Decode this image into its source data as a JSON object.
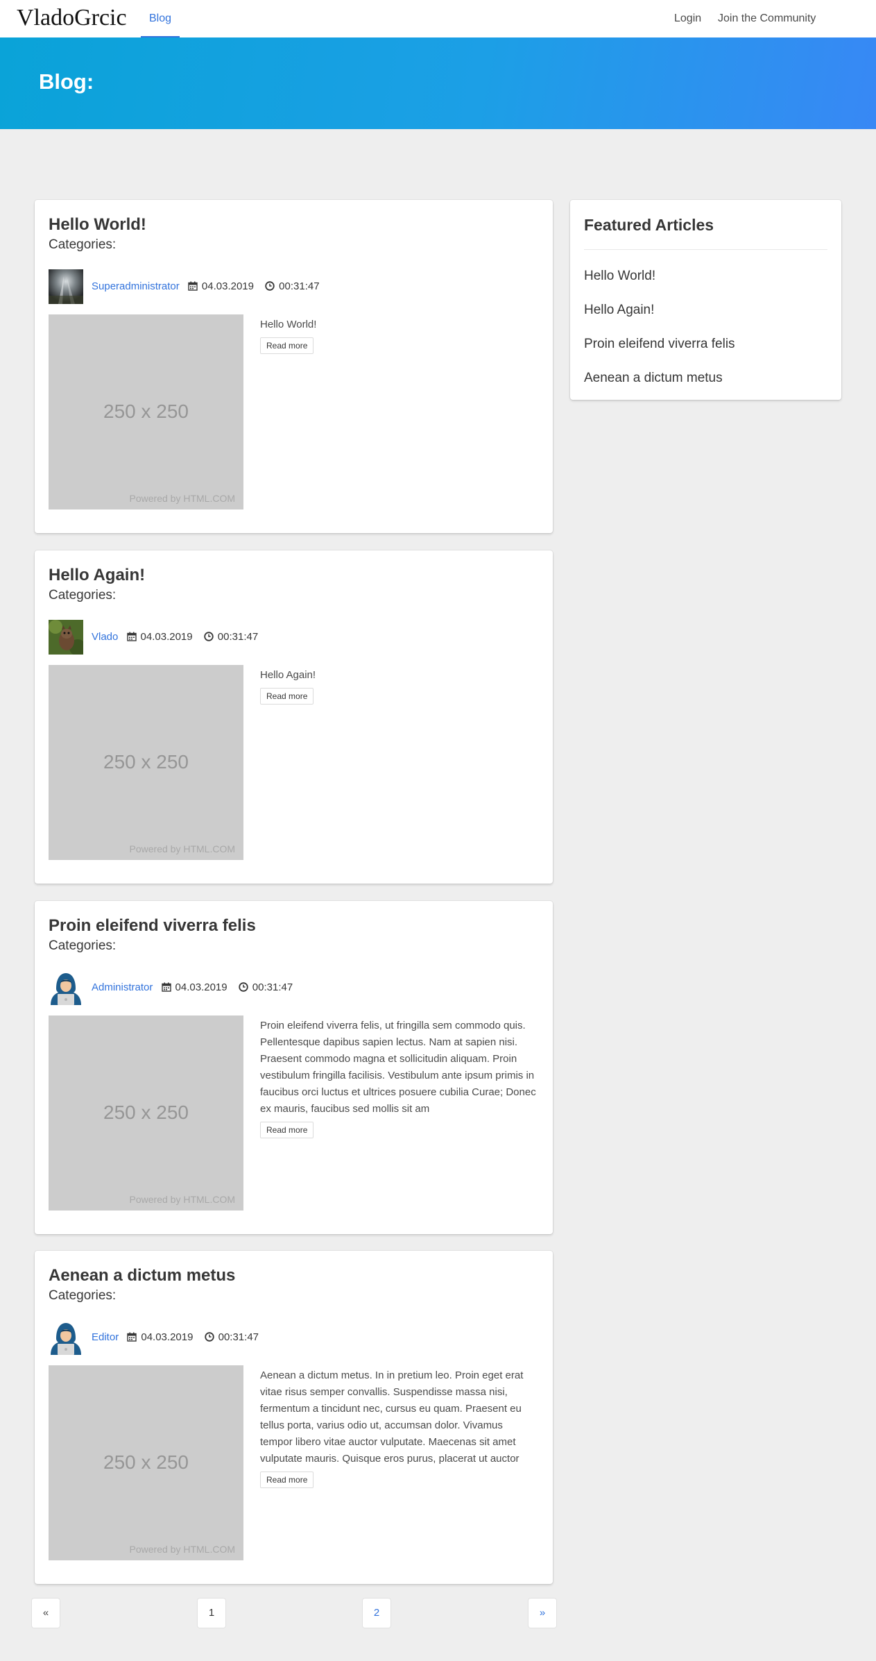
{
  "navbar": {
    "brand": "VladoGrcic",
    "active_tab": "Blog",
    "login": "Login",
    "join": "Join the Community"
  },
  "hero": {
    "title": "Blog:"
  },
  "posts": [
    {
      "title": "Hello World!",
      "categories_label": "Categories:",
      "author": "Superadministrator",
      "date": "04.03.2019",
      "time": "00:31:47",
      "thumb_size": "250 x 250",
      "thumb_powered": "Powered by HTML.COM",
      "excerpt": "Hello World!",
      "read_more": "Read more"
    },
    {
      "title": "Hello Again!",
      "categories_label": "Categories:",
      "author": "Vlado",
      "date": "04.03.2019",
      "time": "00:31:47",
      "thumb_size": "250 x 250",
      "thumb_powered": "Powered by HTML.COM",
      "excerpt": "Hello Again!",
      "read_more": "Read more"
    },
    {
      "title": "Proin eleifend viverra felis",
      "categories_label": "Categories:",
      "author": "Administrator",
      "date": "04.03.2019",
      "time": "00:31:47",
      "thumb_size": "250 x 250",
      "thumb_powered": "Powered by HTML.COM",
      "excerpt": "Proin eleifend viverra felis, ut fringilla sem commodo quis. Pellentesque dapibus sapien lectus. Nam at sapien nisi. Praesent commodo magna et sollicitudin aliquam. Proin vestibulum fringilla facilisis. Vestibulum ante ipsum primis in faucibus orci luctus et ultrices posuere cubilia Curae; Donec ex mauris, faucibus sed mollis sit am",
      "read_more": "Read more"
    },
    {
      "title": "Aenean a dictum metus",
      "categories_label": "Categories:",
      "author": "Editor",
      "date": "04.03.2019",
      "time": "00:31:47",
      "thumb_size": "250 x 250",
      "thumb_powered": "Powered by HTML.COM",
      "excerpt": "Aenean a dictum metus. In in pretium leo. Proin eget erat vitae risus semper convallis. Suspendisse massa nisi, fermentum a tincidunt nec, cursus eu quam. Praesent eu tellus porta, varius odio ut, accumsan dolor. Vivamus tempor libero vitae auctor vulputate. Maecenas sit amet vulputate mauris. Quisque eros purus, placerat ut auctor",
      "read_more": "Read more"
    }
  ],
  "sidebar": {
    "title": "Featured Articles",
    "items": [
      "Hello World!",
      "Hello Again!",
      "Proin eleifend viverra felis",
      "Aenean a dictum metus"
    ]
  },
  "pagination": {
    "prev": "«",
    "page1": "1",
    "page2": "2",
    "next": "»"
  },
  "colors": {
    "link": "#3273dc",
    "hero_start": "#0aa3d8",
    "hero_end": "#3888f5",
    "background": "#eeeeee"
  },
  "icons": [
    "calendar-icon",
    "clock-icon"
  ]
}
